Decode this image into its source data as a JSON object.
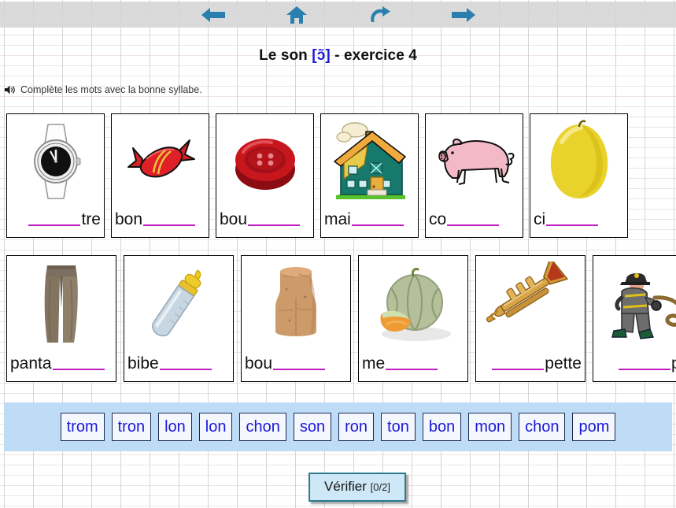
{
  "toolbar": {
    "buttons": [
      {
        "name": "back-arrow-icon",
        "label": "Précédent"
      },
      {
        "name": "home-icon",
        "label": "Accueil"
      },
      {
        "name": "refresh-icon",
        "label": "Recommencer"
      },
      {
        "name": "forward-arrow-icon",
        "label": "Suivant"
      }
    ],
    "icon_color": "#2a7fae"
  },
  "header": {
    "title_prefix": "Le son ",
    "title_phoneme": "[ɔ̃]",
    "title_suffix": " - exercice 4",
    "phoneme_color": "#1a18d8"
  },
  "instruction": {
    "speaker_icon": "speaker-icon",
    "text": "Complète les mots avec la bonne syllabe."
  },
  "rows": [
    {
      "id": "row-1",
      "cards": [
        {
          "picture": "wristwatch-image",
          "blank_first": true,
          "text": "tre"
        },
        {
          "picture": "candy-image",
          "blank_first": false,
          "text": "bon"
        },
        {
          "picture": "button-image",
          "blank_first": false,
          "text": "bou"
        },
        {
          "picture": "house-image",
          "blank_first": false,
          "text": "mai"
        },
        {
          "picture": "pig-image",
          "blank_first": false,
          "text": "co"
        },
        {
          "picture": "lemon-image",
          "blank_first": false,
          "text": "ci"
        }
      ]
    },
    {
      "id": "row-2",
      "cards": [
        {
          "picture": "trousers-image",
          "blank_first": false,
          "text": "panta"
        },
        {
          "picture": "baby-bottle-image",
          "blank_first": false,
          "text": "bibe"
        },
        {
          "picture": "cork-image",
          "blank_first": false,
          "text": "bou"
        },
        {
          "picture": "melon-image",
          "blank_first": false,
          "text": "me"
        },
        {
          "picture": "trumpet-image",
          "blank_first": true,
          "text": "pette"
        },
        {
          "picture": "firefighter-image",
          "blank_first": true,
          "text": "pier"
        }
      ]
    }
  ],
  "bank": {
    "background_color": "#bedcf6",
    "tile_text_color": "#1a18d8",
    "tiles": [
      "trom",
      "tron",
      "lon",
      "lon",
      "chon",
      "son",
      "ron",
      "ton",
      "bon",
      "mon",
      "chon",
      "pom"
    ]
  },
  "verify": {
    "label": "Vérifier",
    "score": "[0/2]"
  }
}
